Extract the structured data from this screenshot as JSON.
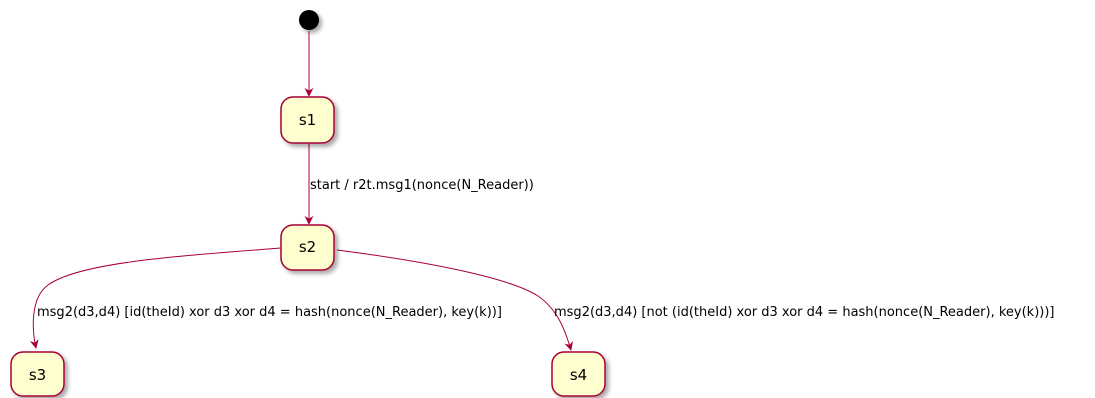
{
  "diagram": {
    "colors": {
      "state_fill": "#FEFECE",
      "state_border": "#A80036",
      "edge": "#A80036",
      "initial": "#000000"
    },
    "states": [
      {
        "id": "s1",
        "label": "s1"
      },
      {
        "id": "s2",
        "label": "s2"
      },
      {
        "id": "s3",
        "label": "s3"
      },
      {
        "id": "s4",
        "label": "s4"
      }
    ],
    "transitions": [
      {
        "from": "initial",
        "to": "s1",
        "label": ""
      },
      {
        "from": "s1",
        "to": "s2",
        "label": "start / r2t.msg1(nonce(N_Reader))"
      },
      {
        "from": "s2",
        "to": "s3",
        "label": "msg2(d3,d4) [id(theId) xor d3 xor d4 = hash(nonce(N_Reader), key(k))]"
      },
      {
        "from": "s2",
        "to": "s4",
        "label": "msg2(d3,d4) [not (id(theId) xor d3 xor d4 = hash(nonce(N_Reader), key(k)))]"
      }
    ]
  }
}
